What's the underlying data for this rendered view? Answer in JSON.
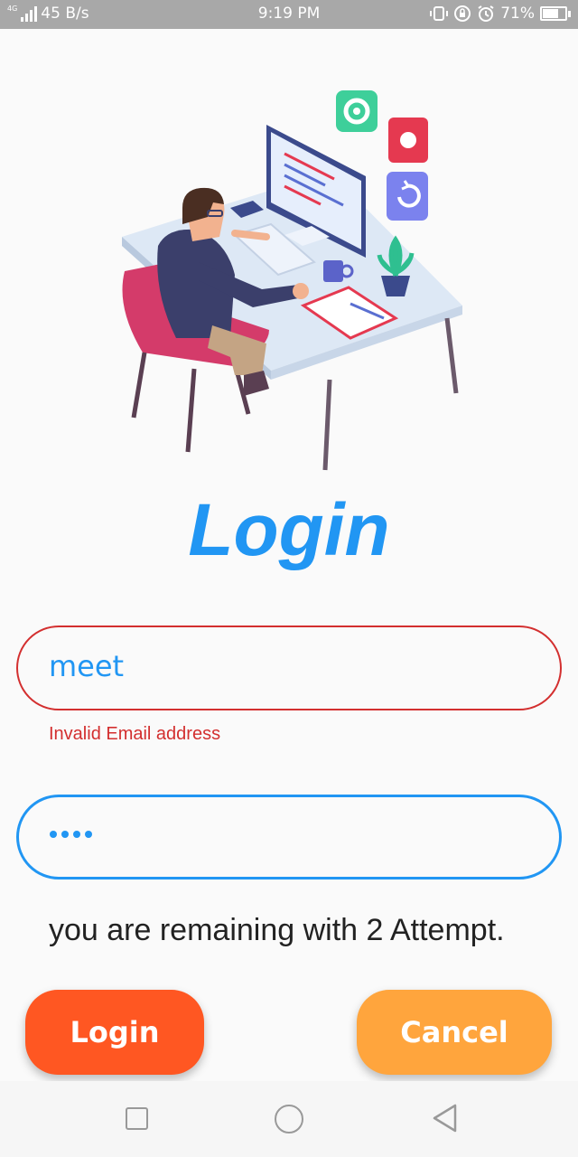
{
  "status_bar": {
    "network_type": "4G",
    "speed": "45 B/s",
    "time": "9:19 PM",
    "battery": "71%",
    "battery_level": 0.71,
    "icons": [
      "volte-icon",
      "rotation-lock-icon",
      "alarm-icon",
      "battery-icon"
    ]
  },
  "title": "Login",
  "email_field": {
    "value": "meet",
    "error": "Invalid Email address"
  },
  "password_field": {
    "masked_length": 4
  },
  "attempt_message": "you are remaining with 2 Attempt.",
  "buttons": {
    "login_label": "Login",
    "cancel_label": "Cancel"
  },
  "nav": {
    "icons": [
      "recent-apps-icon",
      "home-icon",
      "back-icon"
    ]
  },
  "colors": {
    "primary": "#2196f3",
    "error": "#d32f2f",
    "login_button": "#ff5722",
    "cancel_button": "#ffa53d"
  }
}
